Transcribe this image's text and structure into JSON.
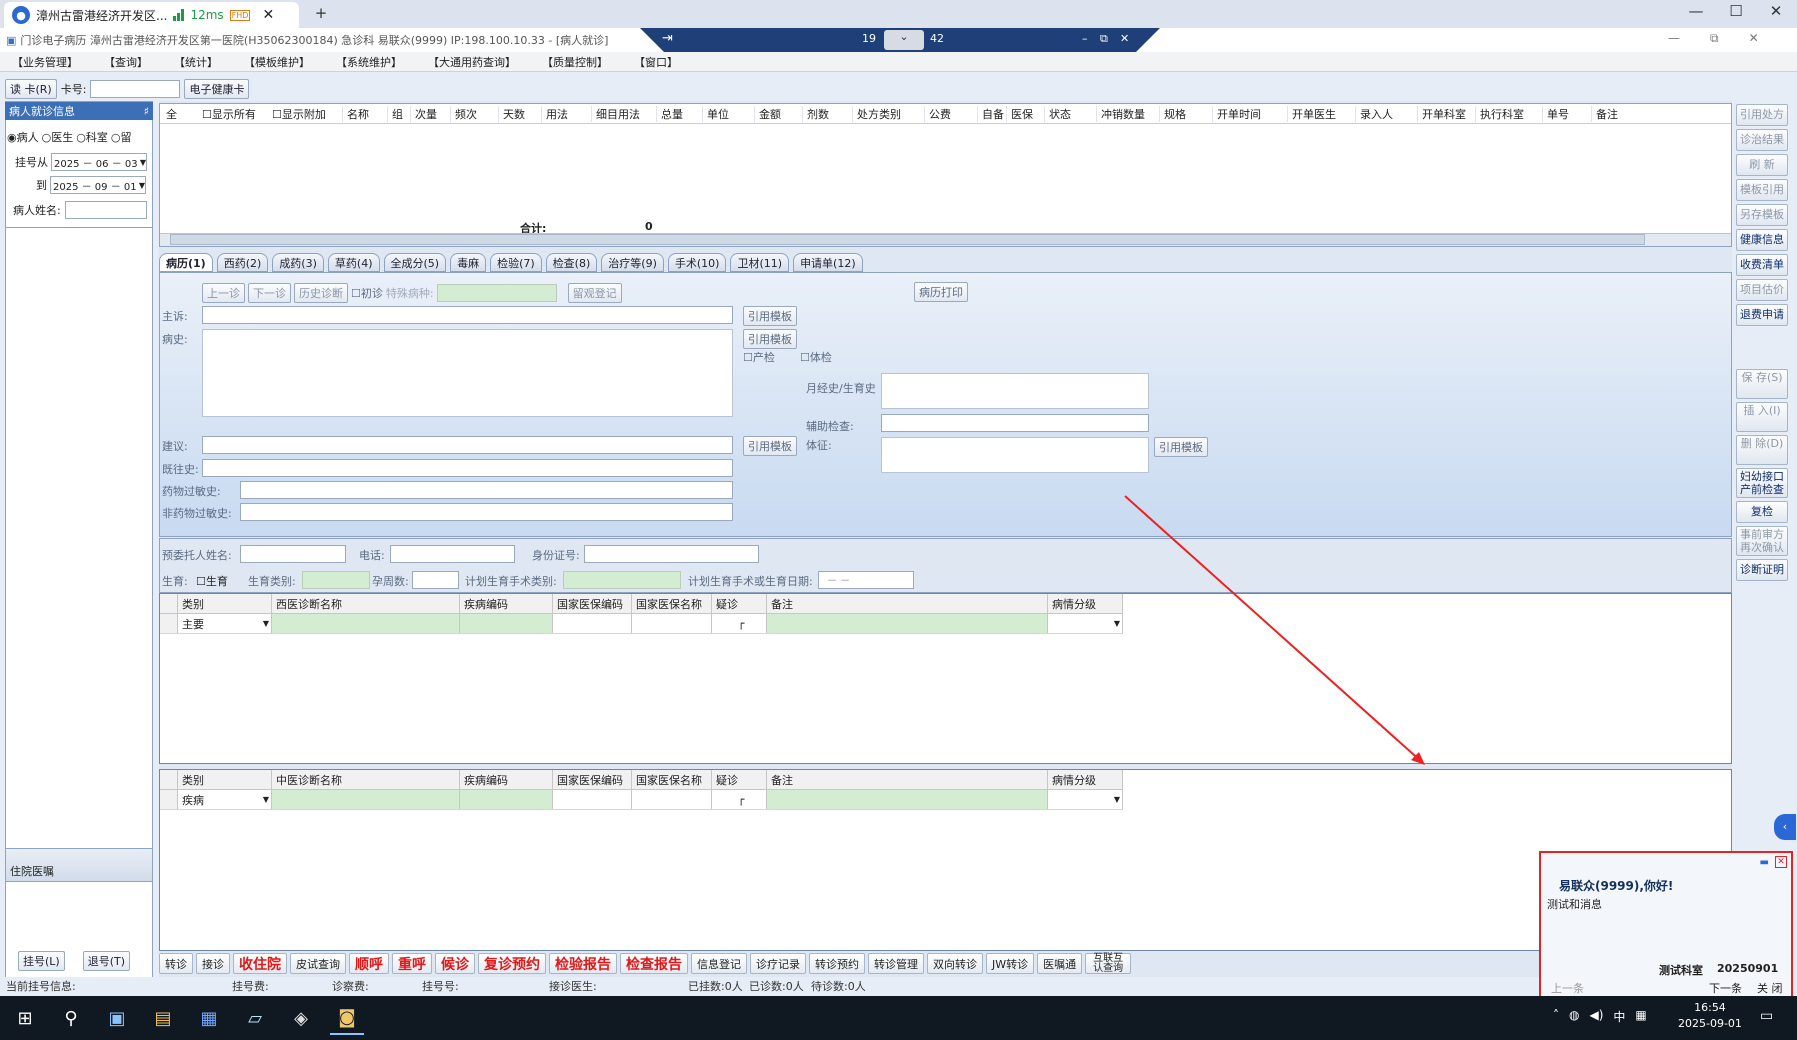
{
  "remote": {
    "tab_title": "漳州古雷港经济开发区...",
    "latency": "12ms",
    "badge": "FHD",
    "new_tab": "+",
    "center_left": "19",
    "center_right": "42",
    "controls": [
      "—",
      "☐",
      "✕"
    ],
    "center_controls": [
      "–",
      "⧉",
      "✕"
    ]
  },
  "app": {
    "title": "门诊电子病历  漳州古雷港经济开发区第一医院(H35062300184)  急诊科   易联众(9999)  IP:198.100.10.33 - [病人就诊]",
    "menu": [
      "【业务管理】",
      "【查询】",
      "【统计】",
      "【模板维护】",
      "【系统维护】",
      "【大通用药查询】",
      "【质量控制】",
      "【窗口】"
    ]
  },
  "cardbar": {
    "read_card": "读 卡(R)",
    "card_no_label": "卡号:",
    "card_no_value": "",
    "health_card": "电子健康卡"
  },
  "left": {
    "header": "病人就诊信息",
    "pin": "♯",
    "radios": [
      "病人",
      "医生",
      "科室",
      "留"
    ],
    "from_label": "挂号从",
    "from_date": "2025 － 06 － 03",
    "to_label": "到",
    "to_date": "2025 － 09 － 01",
    "name_label": "病人姓名:",
    "name_value": "",
    "inpatient": "住院医嘱",
    "reg_btn": "挂号(L)",
    "unreg_btn": "退号(T)"
  },
  "rx_grid": {
    "all": "全",
    "show_all": "显示所有",
    "show_extra": "显示附加",
    "headers": [
      "名称",
      "组",
      "次量",
      "频次",
      "天数",
      "用法",
      "细目用法",
      "总量",
      "单位",
      "金额",
      "剂数",
      "处方类别",
      "公费",
      "自备",
      "医保",
      "状态",
      "冲销数量",
      "规格",
      "开单时间",
      "开单医生",
      "录入人",
      "开单科室",
      "执行科室",
      "单号",
      "备注"
    ],
    "total_label": "合计:",
    "total_value": "0"
  },
  "tabs": [
    "病历(1)",
    "西药(2)",
    "成药(3)",
    "草药(4)",
    "全成分(5)",
    "毒麻",
    "检验(7)",
    "检查(8)",
    "治疗等(9)",
    "手术(10)",
    "卫材(11)",
    "申请单(12)"
  ],
  "record": {
    "prev": "上一诊",
    "next": "下一诊",
    "history": "历史诊断",
    "first_visit": "初诊",
    "special_label": "特殊病种:",
    "observe": "留观登记",
    "print": "病历打印",
    "complaint": "主诉:",
    "history_label": "病史:",
    "cite": "引用模板",
    "prenatal": "产检",
    "physical": "体检",
    "menstrual": "月经史/生育史",
    "aux_exam": "辅助检查:",
    "sign": "体征:",
    "advice": "建议:",
    "past": "既往史:",
    "drug_allergy": "药物过敏史:",
    "nondrug_allergy": "非药物过敏史:",
    "proxy_name": "预委托人姓名:",
    "phone": "电话:",
    "idcard": "身份证号:",
    "birth": "生育:",
    "birth_chk": "生育",
    "birth_type": "生育类别:",
    "gest_weeks": "孕周数:",
    "plan_type": "计划生育手术类别:",
    "plan_date": "计划生育手术或生育日期:",
    "date_placeholder": "－  －"
  },
  "western_dx": {
    "headers": [
      "类别",
      "西医诊断名称",
      "疾病编码",
      "国家医保编码",
      "国家医保名称",
      "疑诊",
      "备注",
      "病情分级"
    ],
    "row_type": "主要"
  },
  "tcm_dx": {
    "headers": [
      "类别",
      "中医诊断名称",
      "疾病编码",
      "国家医保编码",
      "国家医保名称",
      "疑诊",
      "备注",
      "病情分级"
    ],
    "row_type": "疾病"
  },
  "side_buttons": [
    {
      "label": "引用处方",
      "on": false
    },
    {
      "label": "诊治结果",
      "on": false
    },
    {
      "label": "刷 新",
      "on": false
    },
    {
      "label": "模板引用",
      "on": false
    },
    {
      "label": "另存模板",
      "on": false
    },
    {
      "label": "健康信息",
      "on": true
    },
    {
      "label": "收费清单",
      "on": true
    },
    {
      "label": "项目估价",
      "on": false
    },
    {
      "label": "退费申请",
      "on": true
    },
    {
      "label": "保 存(S)",
      "on": false
    },
    {
      "label": "插 入(I)",
      "on": false
    },
    {
      "label": "删 除(D)",
      "on": false
    },
    {
      "label": "妇幼接口产前检查",
      "on": true
    },
    {
      "label": "复检",
      "on": true
    },
    {
      "label": "事前审方再次确认",
      "on": false
    },
    {
      "label": "诊断证明",
      "on": true
    }
  ],
  "actions": [
    {
      "label": "转诊",
      "red": false
    },
    {
      "label": "接诊",
      "red": false
    },
    {
      "label": "收住院",
      "red": true
    },
    {
      "label": "皮试查询",
      "red": false
    },
    {
      "label": "顺呼",
      "red": true
    },
    {
      "label": "重呼",
      "red": true
    },
    {
      "label": "候诊",
      "red": true
    },
    {
      "label": "复诊预约",
      "red": true
    },
    {
      "label": "检验报告",
      "red": true
    },
    {
      "label": "检查报告",
      "red": true
    },
    {
      "label": "信息登记",
      "red": false
    },
    {
      "label": "诊疗记录",
      "red": false
    },
    {
      "label": "转诊预约",
      "red": false
    },
    {
      "label": "转诊管理",
      "red": false
    },
    {
      "label": "双向转诊",
      "red": false
    },
    {
      "label": "JW转诊",
      "red": false
    },
    {
      "label": "医嘱通",
      "red": false
    },
    {
      "label": "互联互认查询",
      "red": false
    }
  ],
  "status": [
    "当前挂号信息:",
    "挂号费:",
    "诊察费:",
    "挂号号:",
    "接诊医生:",
    "已挂数:0人",
    "已诊数:0人",
    "待诊数:0人"
  ],
  "notify": {
    "greeting": "易联众(9999),你好!",
    "message": "测试和消息",
    "sender": "测试科室",
    "date": "20250901",
    "prev": "上一条",
    "next": "下一条",
    "close": "关 闭"
  },
  "clock": {
    "time": "16:54",
    "date": "2025-09-01",
    "ime": "中"
  },
  "colors": {
    "accent": "#e52525",
    "header_blue": "#3d6fb7",
    "green_field": "#d3ecd2"
  }
}
